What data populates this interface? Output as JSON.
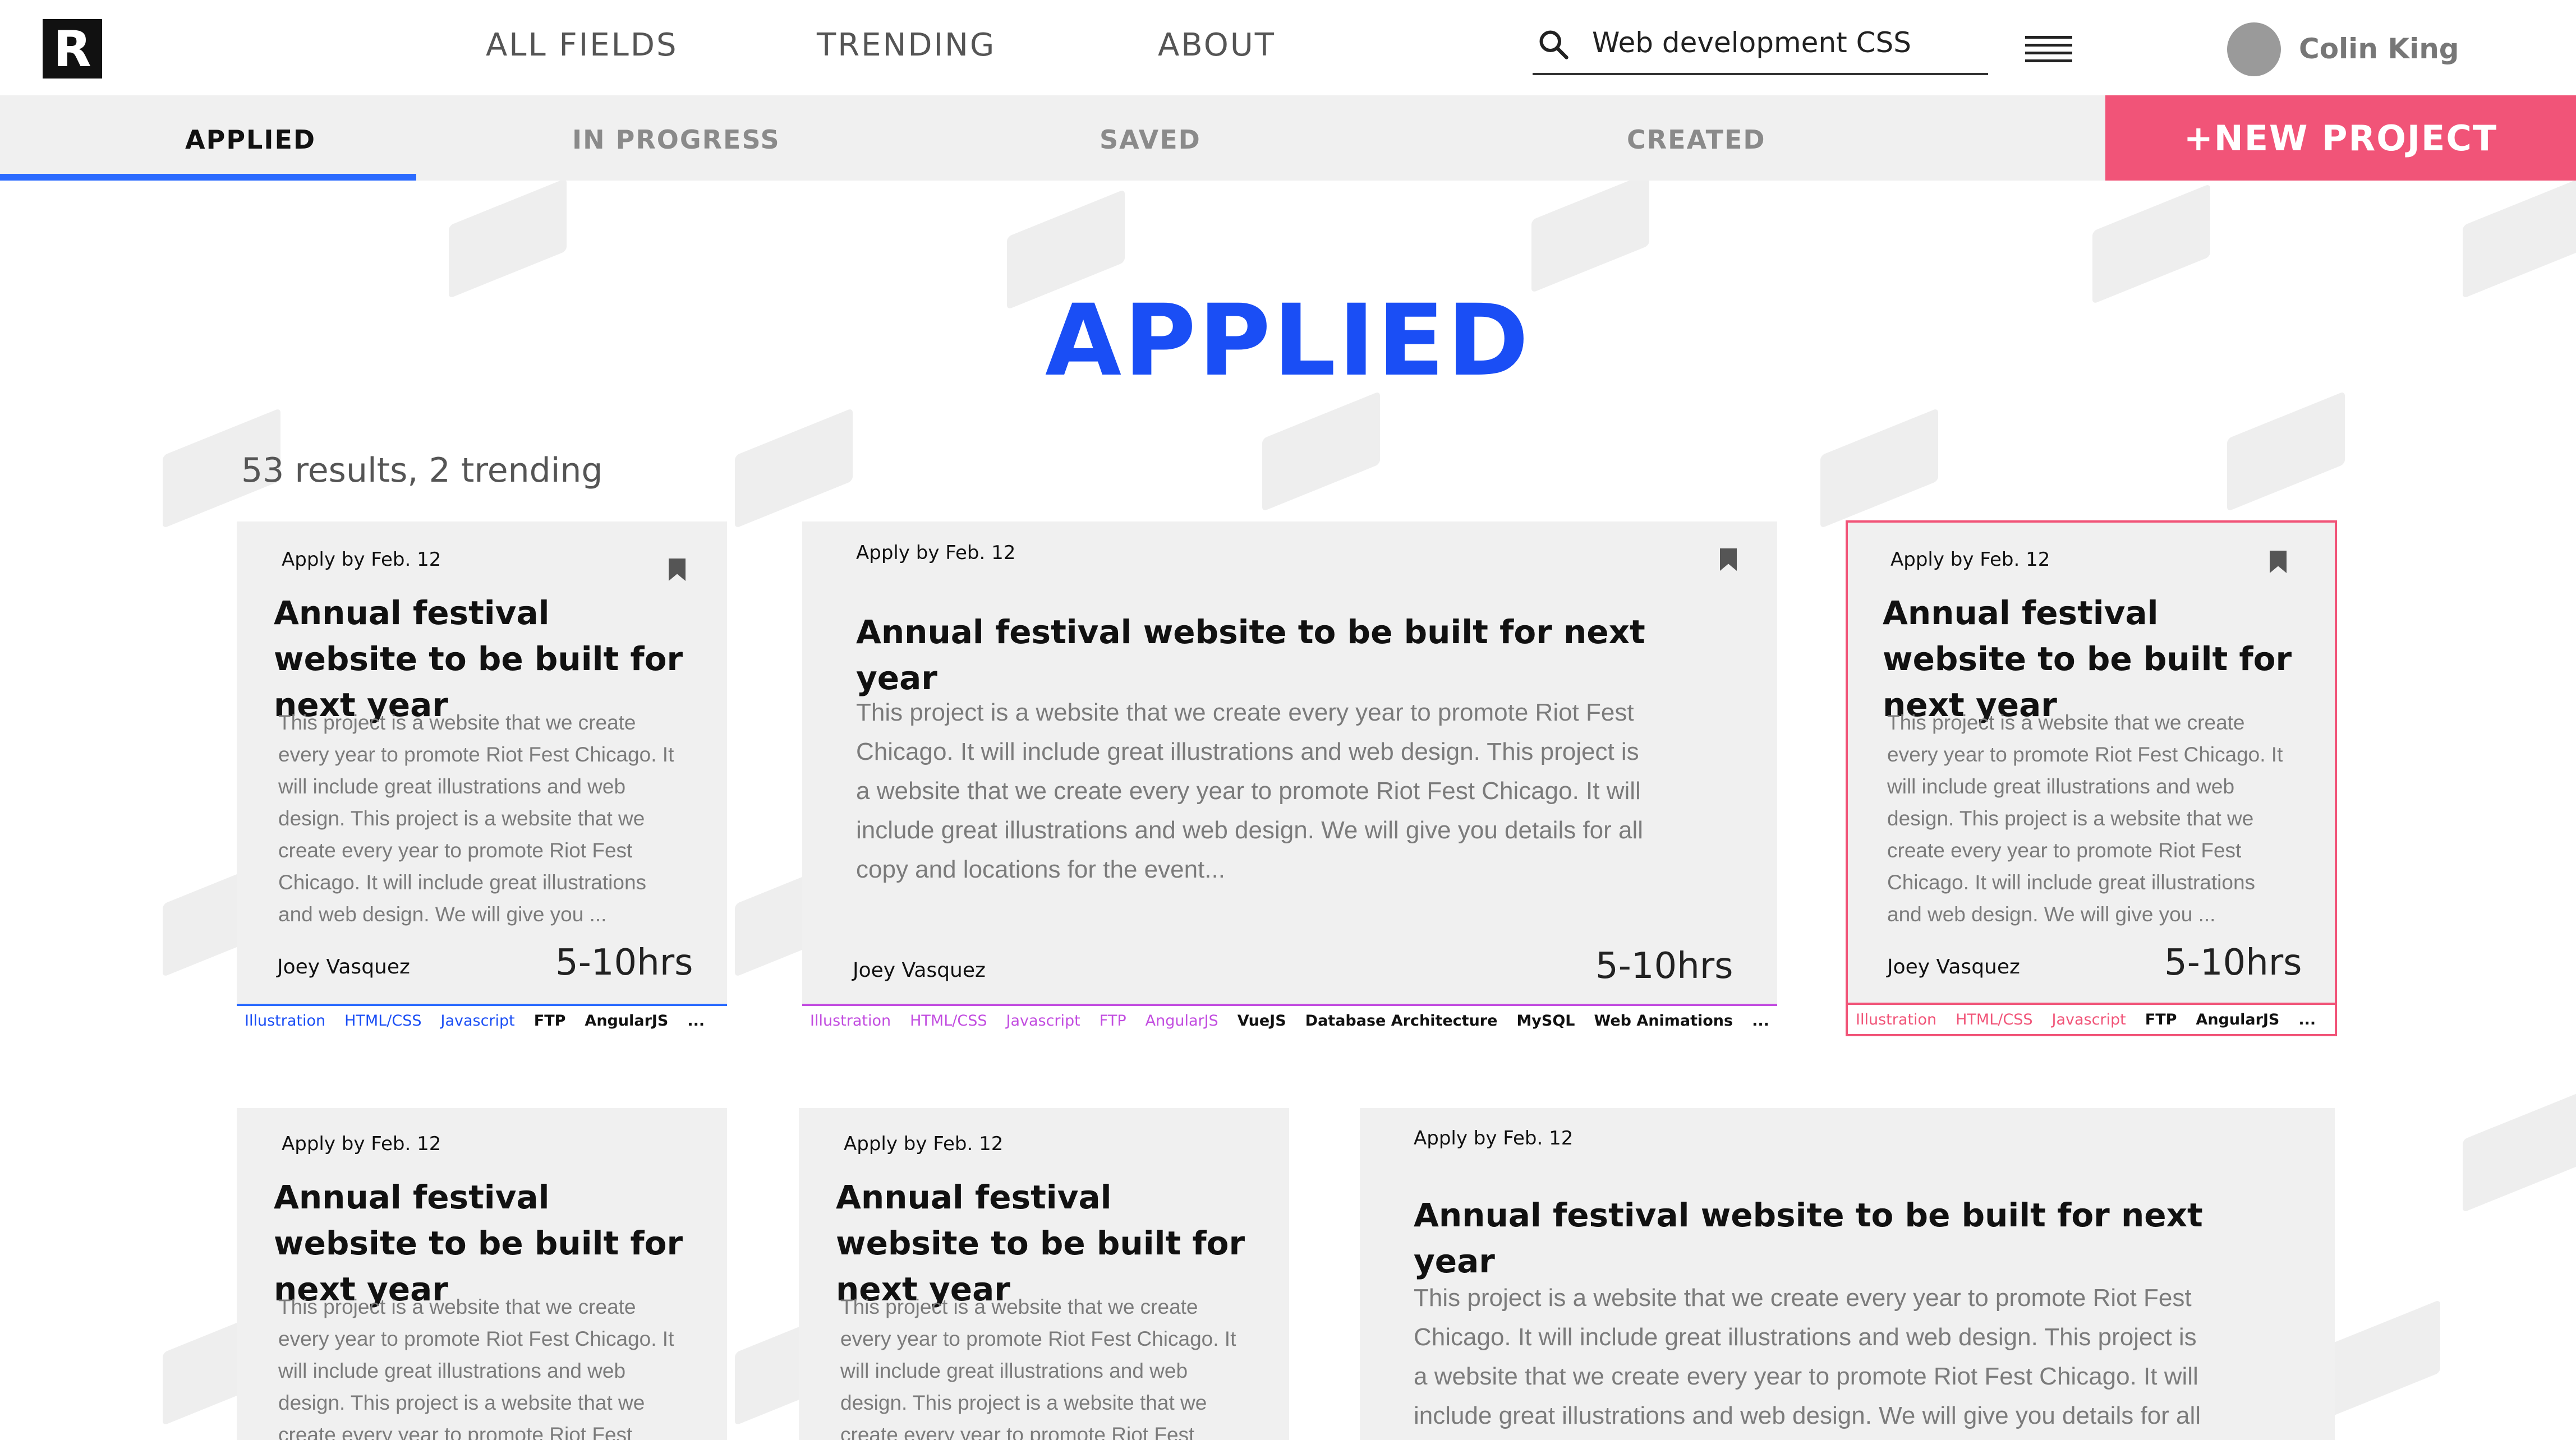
{
  "app": {
    "logo_letter": "R"
  },
  "nav": {
    "items": [
      "ALL FIELDS",
      "TRENDING",
      "ABOUT"
    ]
  },
  "search": {
    "value": "Web development CSS",
    "icon": "search-icon"
  },
  "user": {
    "name": "Colin King"
  },
  "tabs": {
    "items": [
      "APPLIED",
      "IN PROGRESS",
      "SAVED",
      "CREATED"
    ],
    "active": "APPLIED",
    "new_project": "+NEW PROJECT"
  },
  "page": {
    "title": "APPLIED",
    "results": "53 results, 2 trending"
  },
  "colors": {
    "accent_blue": "#1a4ef5",
    "accent_pink": "#f15478",
    "tag_purple": "#c24de0"
  },
  "cards": [
    {
      "apply": "Apply by Feb. 12",
      "title": "Annual festival website to be built for next year",
      "desc": "This project is a website that we create every year to promote Riot Fest Chicago. It will include great illustrations and web design. This project is a website that we create every year to promote Riot Fest Chicago. It will include great illustrations and web design. We will give you ...",
      "author": "Joey Vasquez",
      "hours": "5-10hrs",
      "tags": [
        "Illustration",
        "HTML/CSS",
        "Javascript",
        "FTP",
        "AngularJS",
        "..."
      ]
    },
    {
      "apply": "Apply by Feb. 12",
      "title": "Annual festival website to be built for next year",
      "desc": "This project is a website that we create every year to promote Riot Fest Chicago. It will include great illustrations and web design. This project is a website that we create every year to promote Riot Fest Chicago. It will include great illustrations and web design. We will give you details for all copy and locations for the event...",
      "author": "Joey Vasquez",
      "hours": "5-10hrs",
      "tags": [
        "Illustration",
        "HTML/CSS",
        "Javascript",
        "FTP",
        "AngularJS",
        "VueJS",
        "Database Architecture",
        "MySQL",
        "Web Animations",
        "..."
      ]
    },
    {
      "apply": "Apply by Feb. 12",
      "title": "Annual festival website to be built for next year",
      "desc": "This project is a website that we create every year to promote Riot Fest Chicago. It will include great illustrations and web design. This project is a website that we create every year to promote Riot Fest Chicago. It will include great illustrations and web design. We will give you ...",
      "author": "Joey Vasquez",
      "hours": "5-10hrs",
      "tags": [
        "Illustration",
        "HTML/CSS",
        "Javascript",
        "FTP",
        "AngularJS",
        "..."
      ]
    },
    {
      "apply": "Apply by Feb. 12",
      "title": "Annual festival website to be built for next year",
      "desc": "This project is a website that we create every year to promote Riot Fest Chicago. It will include great illustrations and web design. This project is a website that we create every year to promote Riot Fest"
    },
    {
      "apply": "Apply by Feb. 12",
      "title": "Annual festival website to be built for next year",
      "desc": "This project is a website that we create every year to promote Riot Fest Chicago. It will include great illustrations and web design. This project is a website that we create every year to promote Riot Fest"
    },
    {
      "apply": "Apply by Feb. 12",
      "title": "Annual festival website to be built for next year",
      "desc": "This project is a website that we create every year to promote Riot Fest Chicago. It will include great illustrations and web design. This project is a website that we create every year to promote Riot Fest Chicago. It will include great illustrations and web design. We will give you details for all"
    }
  ]
}
